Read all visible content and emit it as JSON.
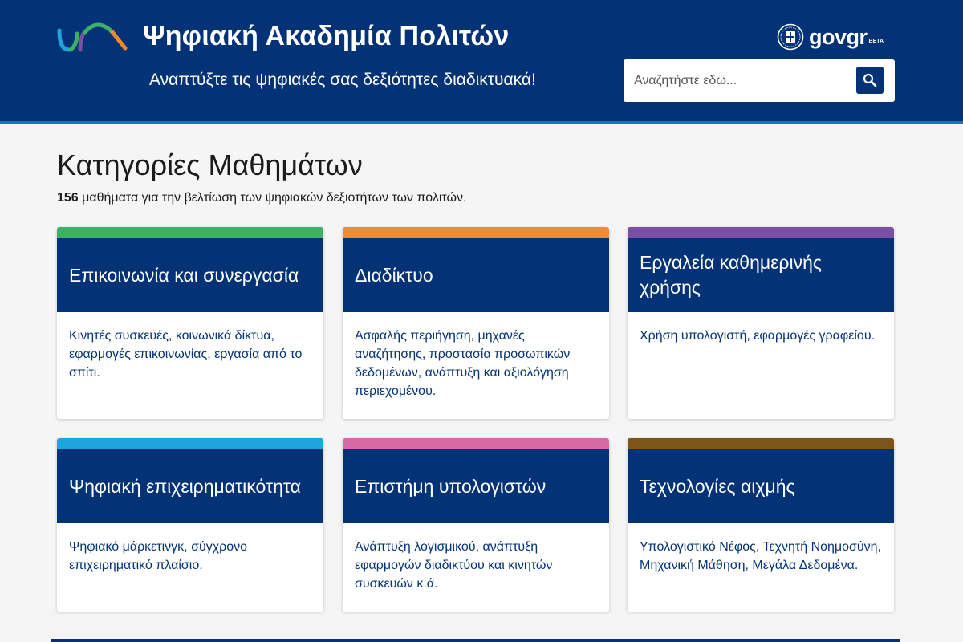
{
  "header": {
    "title": "Ψηφιακή Ακαδημία Πολιτών",
    "tagline": "Αναπτύξτε τις ψηφιακές σας δεξιότητες διαδικτυακά!",
    "gov_logo_text": "govgr",
    "gov_logo_badge": "BETA",
    "search_placeholder": "Αναζητήστε εδώ..."
  },
  "main": {
    "title": "Κατηγορίες Μαθημάτων",
    "summary_count": "156",
    "summary_text": " μαθήματα για την βελτίωση των ψηφιακών δεξιοτήτων των πολιτών."
  },
  "categories": [
    {
      "title": "Επικοινωνία και συνεργασία",
      "description": "Κινητές συσκευές, κοινωνικά δίκτυα, εφαρμογές επικοινωνίας, εργασία από το σπίτι.",
      "accent": "#3cb066"
    },
    {
      "title": "Διαδίκτυο",
      "description": "Ασφαλής περιήγηση, μηχανές αναζήτησης, προστασία προσωπικών δεδομένων, ανάπτυξη και αξιολόγηση περιεχομένου.",
      "accent": "#f58a2b"
    },
    {
      "title": "Εργαλεία καθημερινής χρήσης",
      "description": "Χρήση υπολογιστή, εφαρμογές γραφείου.",
      "accent": "#7b4fa3"
    },
    {
      "title": "Ψηφιακή επιχειρηματικότητα",
      "description": "Ψηφιακό μάρκετινγκ, σύγχρονο επιχειρηματικό πλαίσιο.",
      "accent": "#1ea5e0"
    },
    {
      "title": "Επιστήμη υπολογιστών",
      "description": "Ανάπτυξη λογισμικού, ανάπτυξη εφαρμογών διαδικτύου και κινητών συσκευών κ.ά.",
      "accent": "#d76aa5"
    },
    {
      "title": "Τεχνολογίες αιχμής",
      "description": "Υπολογιστικό Νέφος, Τεχνητή Νοημοσύνη,  Μηχανική Μάθηση, Μεγάλα Δεδομένα.",
      "accent": "#7d5516"
    }
  ],
  "colors": {
    "primary": "#033376",
    "header_border": "#0c78c8"
  },
  "icons": {
    "search": "search-icon",
    "site_logo": "academy-logo-icon",
    "gov_emblem": "greek-emblem-icon"
  }
}
